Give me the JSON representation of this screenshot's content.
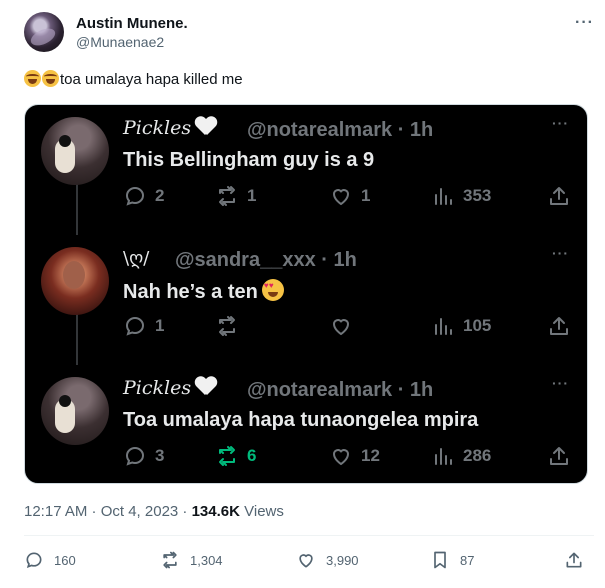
{
  "author": {
    "name": "Austin Munene.",
    "handle": "@Munaenae2"
  },
  "tweet": {
    "text": "toa umalaya hapa killed me",
    "emoji": [
      "rolling-on-floor-laughing",
      "rolling-on-floor-laughing"
    ]
  },
  "more_glyph": "···",
  "quoted": [
    {
      "name": "Pickles",
      "handle": "@notarealmark",
      "time": "· 1h",
      "text": "This Bellingham guy is a 9",
      "replies": "2",
      "retweets": "1",
      "likes": "1",
      "views": "353",
      "retweeted": false
    },
    {
      "name_deco": "\\ღ/",
      "handle": "@sandra__xxx",
      "time": "· 1h",
      "text": "Nah he’s a ten",
      "replies": "1",
      "retweets": "",
      "likes": "",
      "views": "105",
      "retweeted": false
    },
    {
      "name": "Pickles",
      "handle": "@notarealmark",
      "time": "· 1h",
      "text": "Toa umalaya hapa tunaongelea mpira",
      "replies": "3",
      "retweets": "6",
      "likes": "12",
      "views": "286",
      "retweeted": true
    }
  ],
  "meta": {
    "time": "12:17 AM · Oct 4, 2023 · ",
    "views": "134.6K",
    "views_label": " Views"
  },
  "stats": {
    "replies": "160",
    "retweets": "1,304",
    "likes": "3,990",
    "bookmarks": "87"
  },
  "colors": {
    "retweet_active": "#00ba7c",
    "muted": "#536471",
    "media_bg": "#000000"
  }
}
